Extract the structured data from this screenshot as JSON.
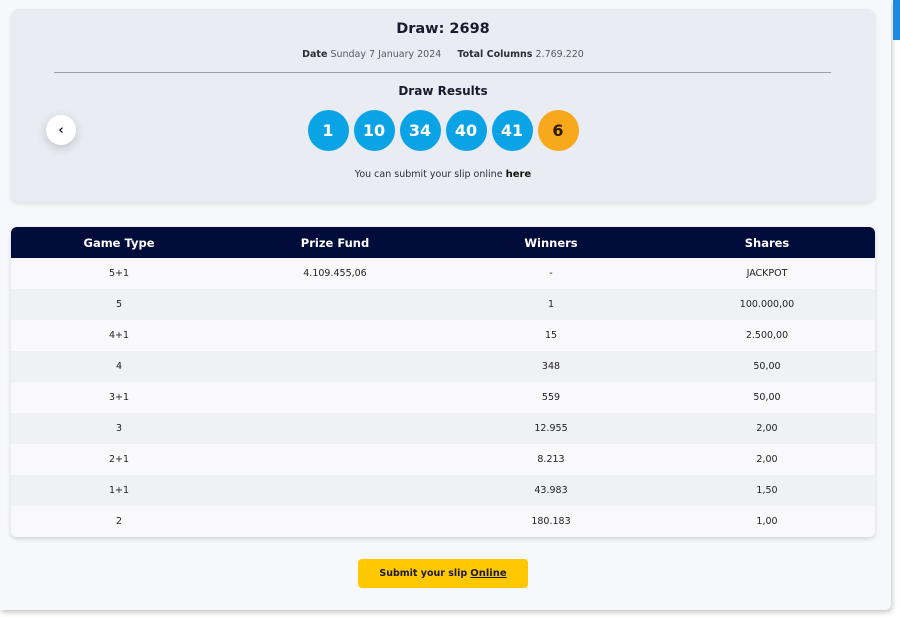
{
  "draw": {
    "title": "Draw: 2698",
    "date_label": "Date",
    "date_value": "Sunday 7 January 2024",
    "columns_label": "Total Columns",
    "columns_value": "2.769.220"
  },
  "results": {
    "heading": "Draw Results",
    "numbers": [
      "1",
      "10",
      "34",
      "40",
      "41"
    ],
    "bonus": "6",
    "submit_text": "You can submit your slip online",
    "submit_link": "here",
    "prev_icon": "chevron-left-icon"
  },
  "table": {
    "headers": [
      "Game Type",
      "Prize Fund",
      "Winners",
      "Shares"
    ],
    "rows": [
      [
        "5+1",
        "4.109.455,06",
        "-",
        "JACKPOT"
      ],
      [
        "5",
        "",
        "1",
        "100.000,00"
      ],
      [
        "4+1",
        "",
        "15",
        "2.500,00"
      ],
      [
        "4",
        "",
        "348",
        "50,00"
      ],
      [
        "3+1",
        "",
        "559",
        "50,00"
      ],
      [
        "3",
        "",
        "12.955",
        "2,00"
      ],
      [
        "2+1",
        "",
        "8.213",
        "2,00"
      ],
      [
        "1+1",
        "",
        "43.983",
        "1,50"
      ],
      [
        "2",
        "",
        "180.183",
        "1,00"
      ]
    ]
  },
  "cta": {
    "label": "Submit your slip",
    "link": "Online"
  },
  "colors": {
    "ball": "#0aa3e6",
    "bonus_ball": "#f8a81b",
    "table_header": "#020c3a",
    "cta": "#ffc800"
  }
}
